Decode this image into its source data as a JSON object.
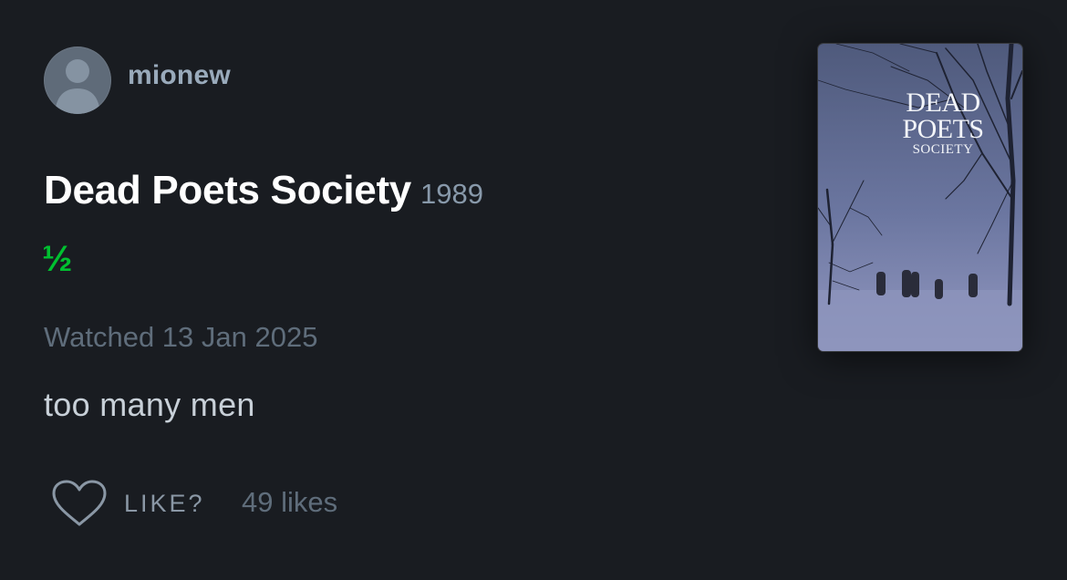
{
  "review": {
    "username": "mionew",
    "film_title": "Dead Poets Society",
    "film_year": "1989",
    "rating": "½",
    "watched": "Watched 13 Jan 2025",
    "text": "too many men"
  },
  "actions": {
    "like_label": "LIKE?",
    "likes_count": "49 likes"
  },
  "poster": {
    "line1": "DEAD",
    "line2": "POETS",
    "line3": "SOCIETY"
  },
  "colors": {
    "background": "#191c21",
    "rating_green": "#00c030",
    "username": "#99aabb",
    "muted": "#5f6d7b"
  },
  "icons": {
    "avatar": "default-person-avatar-icon",
    "like": "heart-outline-icon"
  }
}
